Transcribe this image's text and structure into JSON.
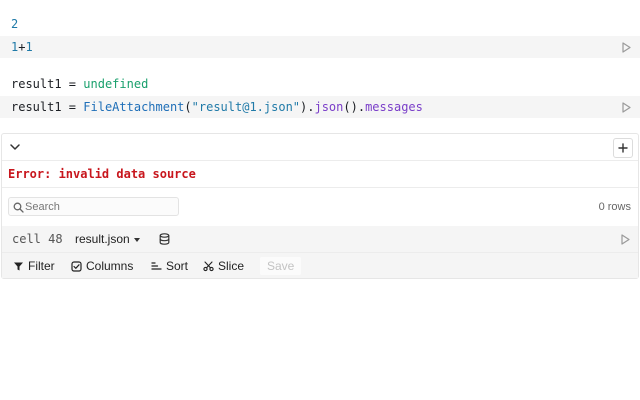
{
  "outputs": {
    "line1": "2",
    "line2": "result1",
    "line2_op": " = ",
    "line2_value": "undefined"
  },
  "cells": {
    "cell1": {
      "left": "1",
      "op": "+",
      "right": "1"
    },
    "cell2": {
      "var": "result1",
      "op": " = ",
      "fn": "FileAttachment",
      "open": "(",
      "str": "\"result@1.json\"",
      "close": ").",
      "json": "json",
      "call": "().",
      "prop": "messages"
    }
  },
  "table": {
    "error": "Error: invalid data source",
    "search_placeholder": "Search",
    "rows_count": "0 rows",
    "cell_label": "cell 48",
    "file_name": "result.json",
    "toolbar": {
      "filter": "Filter",
      "columns": "Columns",
      "sort": "Sort",
      "slice": "Slice",
      "save": "Save"
    }
  },
  "colors": {
    "error": "#c8161d",
    "number": "#1f7aa8",
    "undefined": "#1aa06d",
    "property": "#7a3ec9"
  }
}
